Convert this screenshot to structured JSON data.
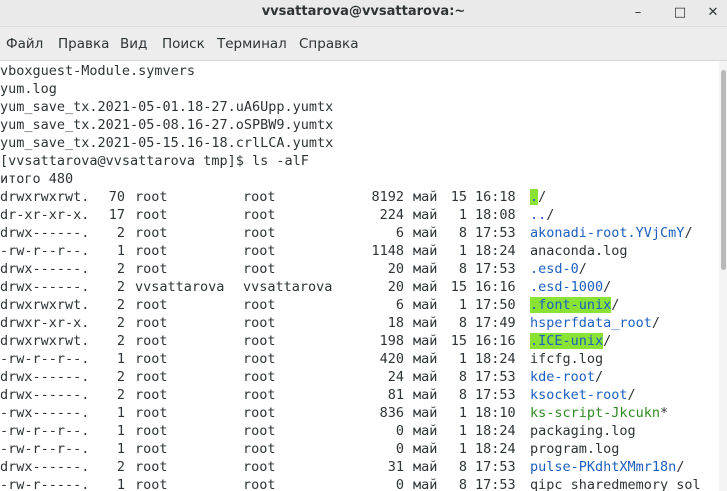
{
  "window": {
    "title": "vvsattarova@vvsattarova:~",
    "minimize_glyph": "–",
    "maximize_glyph": "□",
    "close_glyph": "✕"
  },
  "menu": [
    "Файл",
    "Правка",
    "Вид",
    "Поиск",
    "Терминал",
    "Справка"
  ],
  "terminal": {
    "pre_lines": [
      "vboxguest-Module.symvers",
      "yum.log",
      "yum_save_tx.2021-05-01.18-27.uA6Upp.yumtx",
      "yum_save_tx.2021-05-08.16-27.oSPBW9.yumtx",
      "yum_save_tx.2021-05-15.16-18.crlLCA.yumtx",
      "[vvsattarova@vvsattarova tmp]$ ls -alF",
      "итого 480"
    ],
    "rows": [
      {
        "perm": "drwxrwxrwt.",
        "links": "70",
        "owner": "root",
        "group": "root",
        "size": "8192",
        "month": "май",
        "day": "15",
        "time": "16:18",
        "name": ".",
        "suffix": "/",
        "style": "hl"
      },
      {
        "perm": "dr-xr-xr-x.",
        "links": "17",
        "owner": "root",
        "group": "root",
        "size": "224",
        "month": "май",
        "day": "1",
        "time": "18:08",
        "name": "..",
        "suffix": "/",
        "style": "blue"
      },
      {
        "perm": "drwx------.",
        "links": "2",
        "owner": "root",
        "group": "root",
        "size": "6",
        "month": "май",
        "day": "8",
        "time": "17:53",
        "name": "akonadi-root.YVjCmY",
        "suffix": "/",
        "style": "blue"
      },
      {
        "perm": "-rw-r--r--.",
        "links": "1",
        "owner": "root",
        "group": "root",
        "size": "1148",
        "month": "май",
        "day": "1",
        "time": "18:24",
        "name": "anaconda.log",
        "suffix": "",
        "style": "plain"
      },
      {
        "perm": "drwx------.",
        "links": "2",
        "owner": "root",
        "group": "root",
        "size": "20",
        "month": "май",
        "day": "8",
        "time": "17:53",
        "name": ".esd-0",
        "suffix": "/",
        "style": "blue"
      },
      {
        "perm": "drwx------.",
        "links": "2",
        "owner": "vvsattarova",
        "group": "vvsattarova",
        "size": "20",
        "month": "май",
        "day": "15",
        "time": "16:16",
        "name": ".esd-1000",
        "suffix": "/",
        "style": "blue"
      },
      {
        "perm": "drwxrwxrwt.",
        "links": "2",
        "owner": "root",
        "group": "root",
        "size": "6",
        "month": "май",
        "day": "1",
        "time": "17:50",
        "name": ".font-unix",
        "suffix": "/",
        "style": "hl"
      },
      {
        "perm": "drwxr-xr-x.",
        "links": "2",
        "owner": "root",
        "group": "root",
        "size": "18",
        "month": "май",
        "day": "8",
        "time": "17:49",
        "name": "hsperfdata_root",
        "suffix": "/",
        "style": "blue"
      },
      {
        "perm": "drwxrwxrwt.",
        "links": "2",
        "owner": "root",
        "group": "root",
        "size": "198",
        "month": "май",
        "day": "15",
        "time": "16:16",
        "name": ".ICE-unix",
        "suffix": "/",
        "style": "hl"
      },
      {
        "perm": "-rw-r--r--.",
        "links": "1",
        "owner": "root",
        "group": "root",
        "size": "420",
        "month": "май",
        "day": "1",
        "time": "18:24",
        "name": "ifcfg.log",
        "suffix": "",
        "style": "plain"
      },
      {
        "perm": "drwx------.",
        "links": "2",
        "owner": "root",
        "group": "root",
        "size": "24",
        "month": "май",
        "day": "8",
        "time": "17:53",
        "name": "kde-root",
        "suffix": "/",
        "style": "blue"
      },
      {
        "perm": "drwx------.",
        "links": "2",
        "owner": "root",
        "group": "root",
        "size": "81",
        "month": "май",
        "day": "8",
        "time": "17:53",
        "name": "ksocket-root",
        "suffix": "/",
        "style": "blue"
      },
      {
        "perm": "-rwx------.",
        "links": "1",
        "owner": "root",
        "group": "root",
        "size": "836",
        "month": "май",
        "day": "1",
        "time": "18:10",
        "name": "ks-script-Jkcukn",
        "suffix": "*",
        "style": "green"
      },
      {
        "perm": "-rw-r--r--.",
        "links": "1",
        "owner": "root",
        "group": "root",
        "size": "0",
        "month": "май",
        "day": "1",
        "time": "18:24",
        "name": "packaging.log",
        "suffix": "",
        "style": "plain"
      },
      {
        "perm": "-rw-r--r--.",
        "links": "1",
        "owner": "root",
        "group": "root",
        "size": "0",
        "month": "май",
        "day": "1",
        "time": "18:24",
        "name": "program.log",
        "suffix": "",
        "style": "plain"
      },
      {
        "perm": "drwx------.",
        "links": "2",
        "owner": "root",
        "group": "root",
        "size": "31",
        "month": "май",
        "day": "8",
        "time": "17:53",
        "name": "pulse-PKdhtXMmr18n",
        "suffix": "/",
        "style": "blue"
      },
      {
        "perm": "-rw-r-----.",
        "links": "1",
        "owner": "root",
        "group": "root",
        "size": "0",
        "month": "май",
        "day": "8",
        "time": "17:53",
        "name": "qipc_sharedmemory_sol",
        "suffix": "",
        "style": "plain"
      }
    ]
  },
  "colors": {
    "directory": "#1c5fbf",
    "sticky_highlight": "#8ae234",
    "executable": "#2e8b21",
    "text": "#2e3436"
  }
}
